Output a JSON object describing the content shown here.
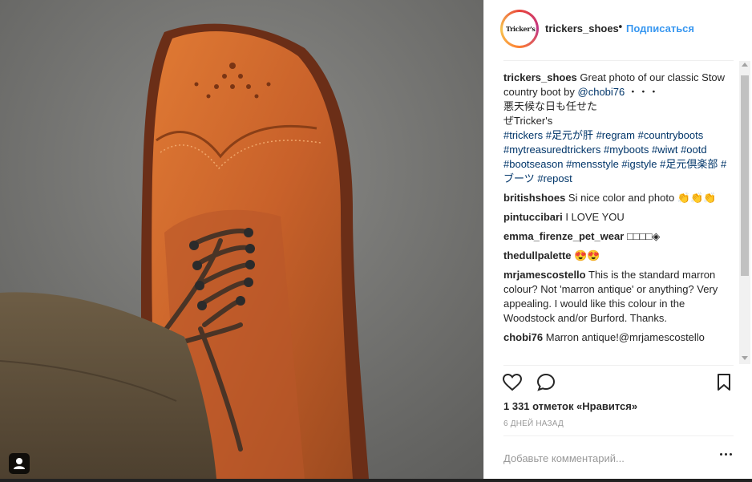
{
  "header": {
    "avatar_text": "Tricker's",
    "username": "trickers_shoes",
    "dot": "•",
    "follow_label": "Подписаться"
  },
  "caption": {
    "user": "trickers_shoes",
    "text_1": "Great photo of our classic Stow country boot by",
    "mention": "@chobi76",
    "text_2": "・・・",
    "text_3": "悪天候な日も任せた",
    "text_4": "ぜTricker's",
    "hashtags": "#trickers #足元が肝 #regram #countryboots #mytreasuredtrickers #myboots #wiwt #ootd #bootseason #mensstyle #igstyle #足元倶楽部 #ブーツ #repost"
  },
  "comments": [
    {
      "user": "britishshoes",
      "text": "Si nice color and photo 👏👏👏"
    },
    {
      "user": "pintuccibari",
      "text": "I LOVE YOU"
    },
    {
      "user": "emma_firenze_pet_wear",
      "text": "□□□□◈"
    },
    {
      "user": "thedullpalette",
      "text": "😍😍"
    },
    {
      "user": "mrjamescostello",
      "text": "This is the standard marron colour? Not 'marron antique' or anything? Very appealing. I would like this colour in the Woodstock and/or Burford. Thanks."
    },
    {
      "user": "chobi76",
      "text": "Marron antique!@mrjamescostello"
    }
  ],
  "actions": {
    "like_icon": "heart-icon",
    "comment_icon": "comment-bubble-icon",
    "save_icon": "bookmark-icon"
  },
  "likes_text": "1 331 отметок «Нравится»",
  "date_text": "6 ДНЕЙ НАЗАД",
  "comment_placeholder": "Добавьте комментарий...",
  "colors": {
    "link": "#3897f0",
    "hashtag": "#003569",
    "muted": "#999999"
  }
}
